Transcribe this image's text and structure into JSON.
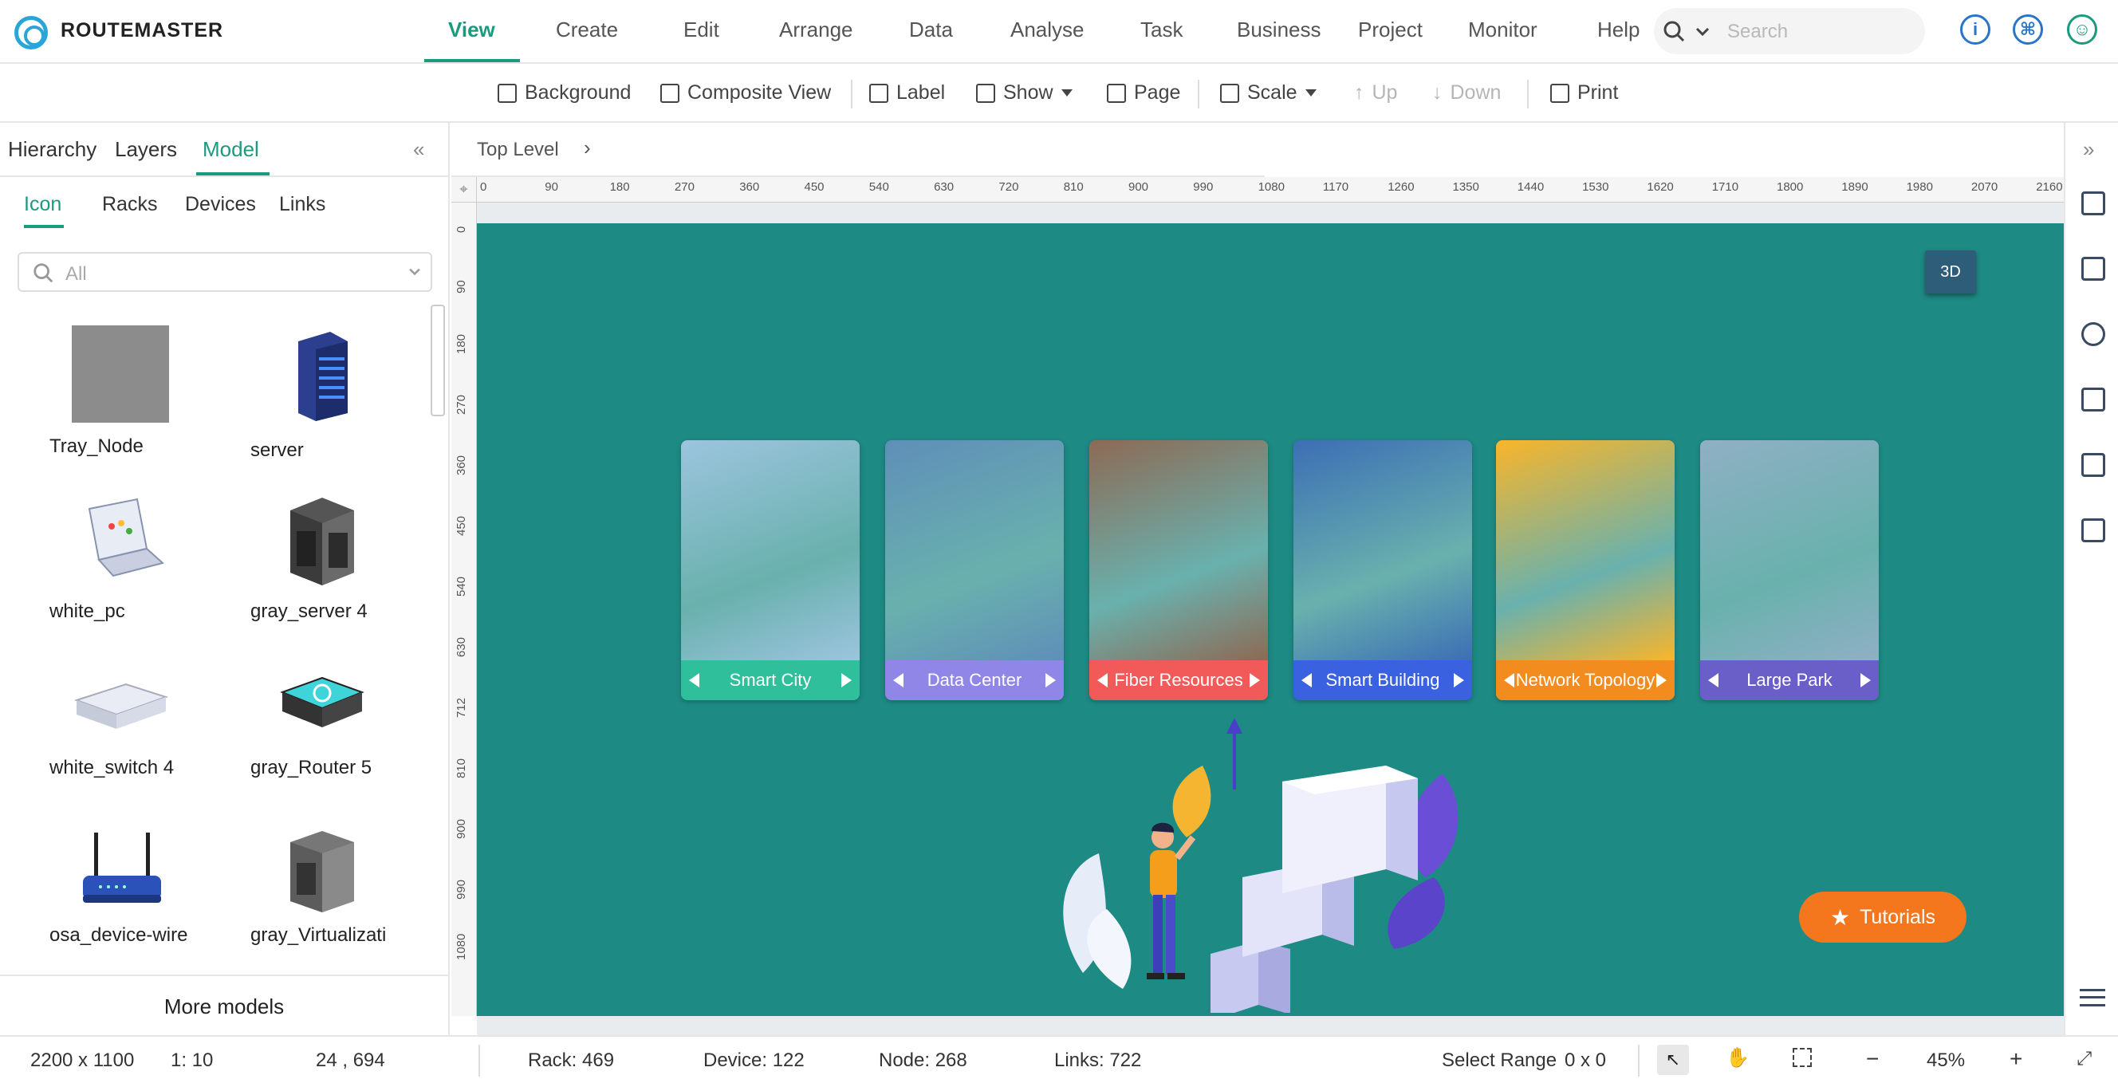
{
  "app": {
    "brand": "ROUTEMASTER"
  },
  "menu": [
    {
      "label": "View",
      "active": true
    },
    {
      "label": "Create"
    },
    {
      "label": "Edit"
    },
    {
      "label": "Arrange"
    },
    {
      "label": "Data"
    },
    {
      "label": "Analyse"
    },
    {
      "label": "Task"
    },
    {
      "label": "Business"
    },
    {
      "label": "Project"
    },
    {
      "label": "Monitor"
    },
    {
      "label": "Help"
    }
  ],
  "search": {
    "placeholder": "Search"
  },
  "header_icons": [
    "info-icon",
    "command-icon",
    "user-icon"
  ],
  "toolbar": {
    "background": "Background",
    "composite_view": "Composite View",
    "label": "Label",
    "show": "Show",
    "page": "Page",
    "scale": "Scale",
    "up": "Up",
    "down": "Down",
    "print": "Print"
  },
  "left_panel": {
    "tabs": [
      "Hierarchy",
      "Layers",
      "Model"
    ],
    "active_tab": "Model",
    "sub_tabs": [
      "Icon",
      "Racks",
      "Devices",
      "Links"
    ],
    "active_sub_tab": "Icon",
    "filter_placeholder": "All",
    "icons": [
      {
        "label": "Tray_Node",
        "icon": "tray-node-icon"
      },
      {
        "label": "server",
        "icon": "server-icon"
      },
      {
        "label": "white_pc",
        "icon": "laptop-icon"
      },
      {
        "label": "gray_server 4",
        "icon": "gray-server-icon"
      },
      {
        "label": "white_switch 4",
        "icon": "switch-icon"
      },
      {
        "label": "gray_Router 5",
        "icon": "router-icon"
      },
      {
        "label": "osa_device-wire",
        "icon": "wireless-router-icon"
      },
      {
        "label": "gray_Virtualizati",
        "icon": "virtualization-icon"
      }
    ],
    "more_models": "More models"
  },
  "breadcrumb": {
    "label": "Top Level"
  },
  "ruler": {
    "h_ticks": [
      "0",
      "90",
      "180",
      "270",
      "360",
      "450",
      "540",
      "630",
      "720",
      "810",
      "900",
      "990",
      "1080",
      "1170",
      "1260",
      "1350",
      "1440",
      "1530",
      "1620",
      "1710",
      "1800",
      "1890",
      "1980",
      "2070",
      "2160"
    ],
    "v_ticks": [
      "0",
      "90",
      "180",
      "270",
      "360",
      "450",
      "540",
      "630",
      "712",
      "810",
      "900",
      "990",
      "1080"
    ]
  },
  "canvas": {
    "btn_3d": "3D",
    "tutorials": "Tutorials",
    "cards": [
      {
        "label": "Smart City",
        "color": "#2fbf9a",
        "img": "#9cc4de"
      },
      {
        "label": "Data Center",
        "color": "#8f86e8",
        "img": "#5f8fb8"
      },
      {
        "label": "Fiber Resources",
        "color": "#f25a5a",
        "img": "#8d6a55"
      },
      {
        "label": "Smart Building",
        "color": "#3a62e0",
        "img": "#3c6fb5"
      },
      {
        "label": "Network Topology",
        "color": "#f28c1e",
        "img": "#f9b52a"
      },
      {
        "label": "Large Park",
        "color": "#6a5fc9",
        "img": "#8fb0c4"
      }
    ]
  },
  "right_icons": [
    "image-icon",
    "list-icon",
    "topology-icon",
    "route-icon",
    "checklist-icon",
    "monitor-icon",
    "menu-icon"
  ],
  "status": {
    "size": "2200 x 1100",
    "ratio": "1: 10",
    "coords": "24 , 694",
    "rack": "Rack: 469",
    "device": "Device: 122",
    "node": "Node: 268",
    "links": "Links: 722",
    "select_range_label": "Select Range",
    "select_range_value": "0 x 0",
    "zoom": "45%",
    "zoom_minus": "−",
    "zoom_plus": "+"
  }
}
